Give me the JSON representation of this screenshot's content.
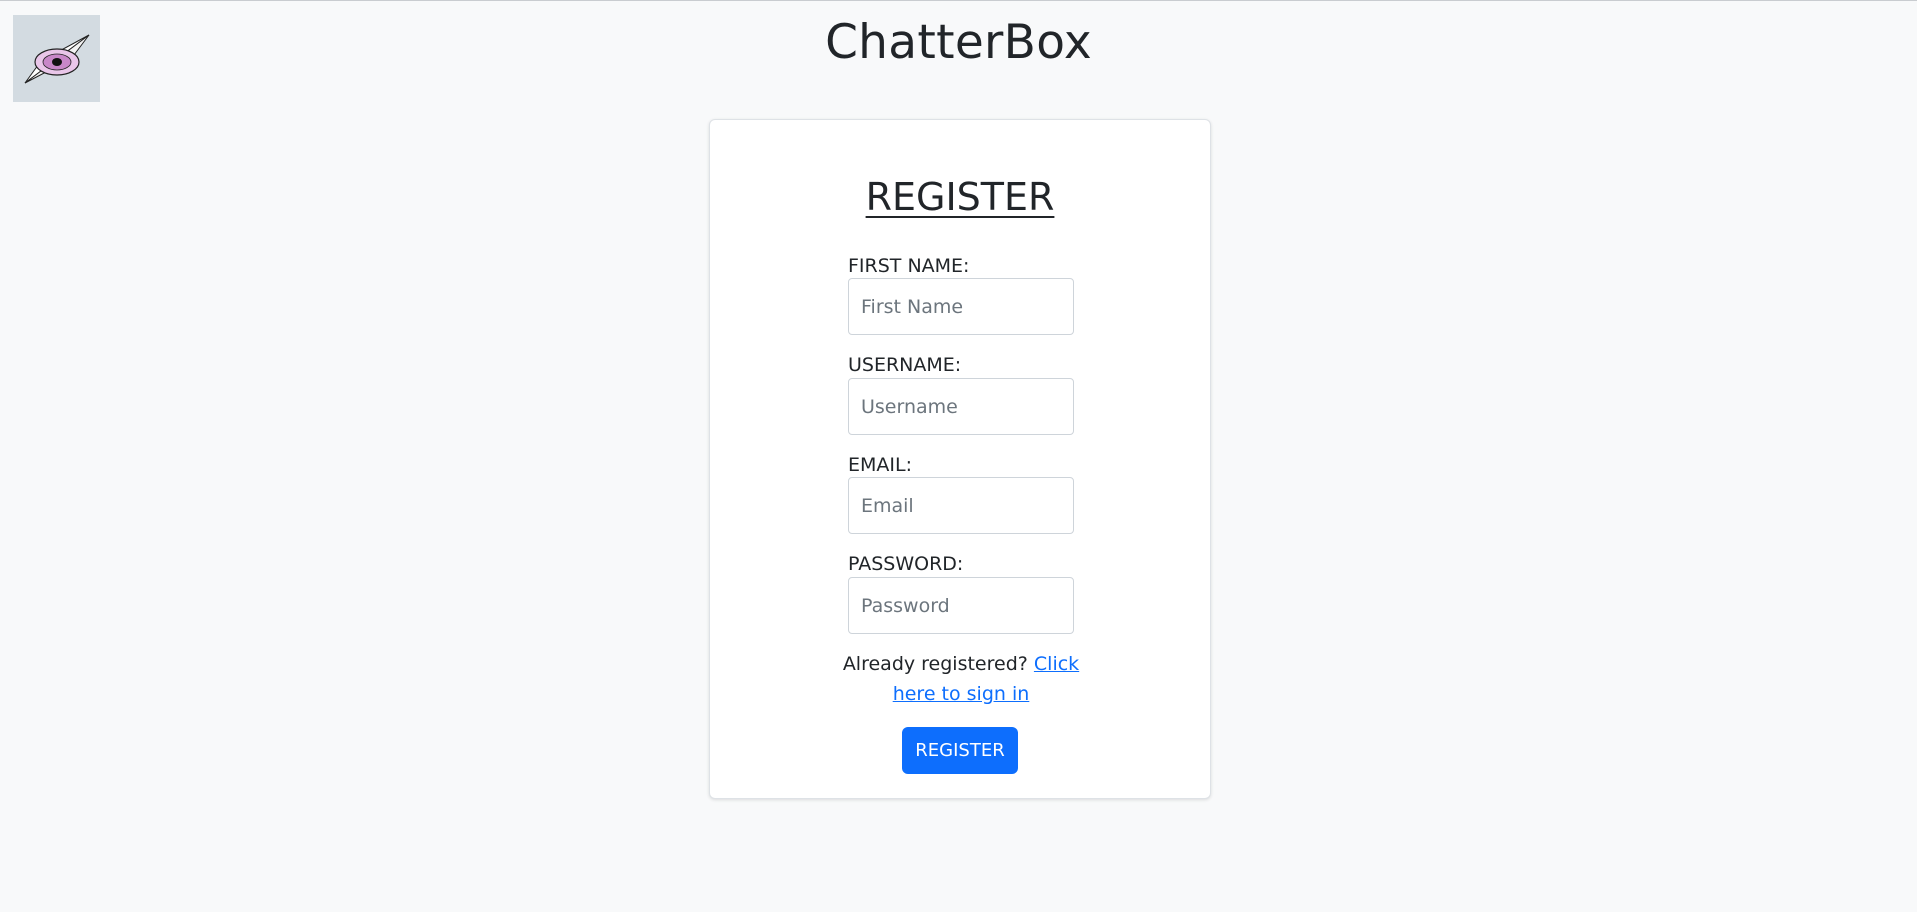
{
  "header": {
    "app_title": "ChatterBox",
    "logo_icon": "eye-compass-logo-icon"
  },
  "form": {
    "title": "REGISTER",
    "fields": [
      {
        "label": "FIRST NAME:",
        "placeholder": "First Name",
        "value": ""
      },
      {
        "label": "USERNAME:",
        "placeholder": "Username",
        "value": ""
      },
      {
        "label": "EMAIL:",
        "placeholder": "Email",
        "value": ""
      },
      {
        "label": "PASSWORD:",
        "placeholder": "Password",
        "value": ""
      }
    ],
    "signin_prompt": "Already registered?",
    "signin_link": "Click here to sign in",
    "submit_label": "REGISTER"
  },
  "colors": {
    "background": "#f8f9fa",
    "primary": "#0d6efd",
    "card": "#ffffff",
    "logo_bg": "#d3dbe1"
  }
}
